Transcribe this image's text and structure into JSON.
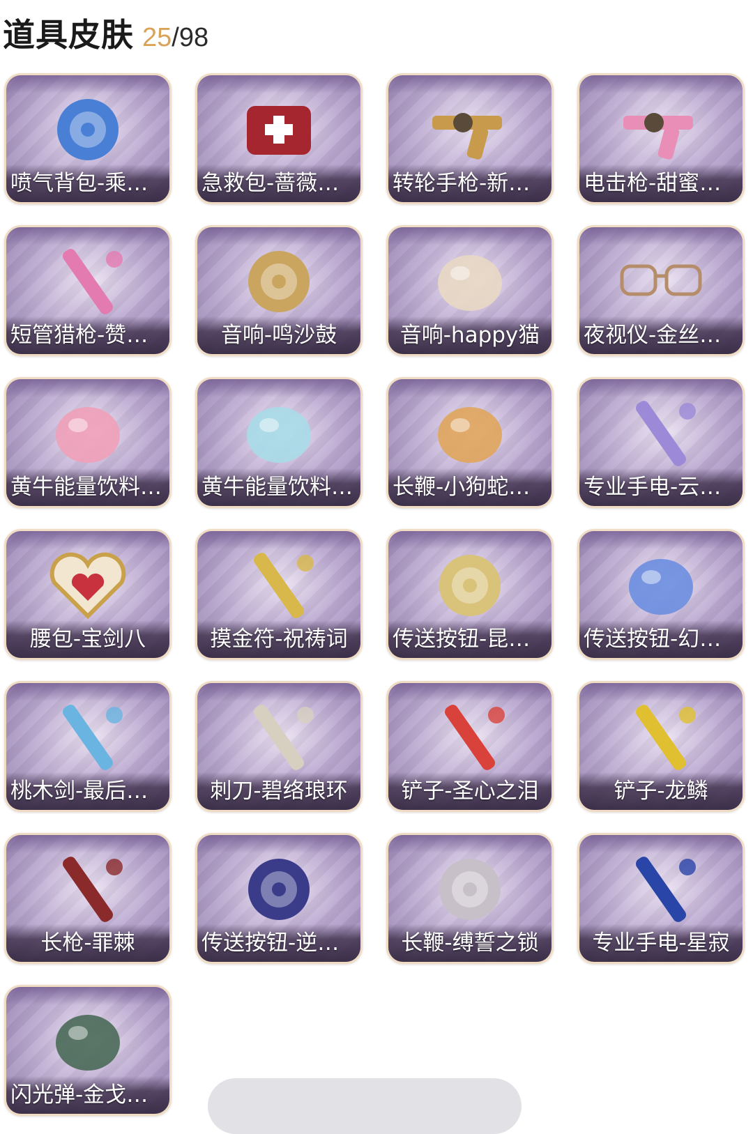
{
  "header": {
    "title": "道具皮肤",
    "count_current": "25",
    "count_total": "/98"
  },
  "items": [
    {
      "label": "喷气背包-乘风…",
      "icon": "jetpack-icon",
      "color": "#4a7fd6"
    },
    {
      "label": "急救包-蔷薇物…",
      "icon": "medkit-icon",
      "color": "#a5262f"
    },
    {
      "label": "转轮手枪-新星…",
      "icon": "revolver-icon",
      "color": "#c79a4c"
    },
    {
      "label": "电击枪-甜蜜泡…",
      "icon": "stun-gun-icon",
      "color": "#e98fb7"
    },
    {
      "label": "短管猎枪-赞萌…",
      "icon": "shotgun-icon",
      "color": "#e37ab0"
    },
    {
      "label": "音响-鸣沙鼓",
      "icon": "drum-icon",
      "color": "#c9a560"
    },
    {
      "label": "音响-happy猫",
      "icon": "cat-icon",
      "color": "#e8d8c4"
    },
    {
      "label": "夜视仪-金丝眼…",
      "icon": "glasses-icon",
      "color": "#b58d6a"
    },
    {
      "label": "黄牛能量饮料-…",
      "icon": "drink-cup-icon",
      "color": "#f0a0b8"
    },
    {
      "label": "黄牛能量饮料-…",
      "icon": "bottle-icon",
      "color": "#a8dbe8"
    },
    {
      "label": "长鞭-小狗蛇点…",
      "icon": "snake-icon",
      "color": "#e0a55c"
    },
    {
      "label": "专业手电-云端…",
      "icon": "flashlight-icon",
      "color": "#9c8ad8"
    },
    {
      "label": "腰包-宝剑八",
      "icon": "heart-bag-icon",
      "color": "#c8323e"
    },
    {
      "label": "摸金符-祝祷词",
      "icon": "amulet-icon",
      "color": "#d8b84a"
    },
    {
      "label": "传送按钮-昆仑…",
      "icon": "portal-ring-icon",
      "color": "#d9c27a"
    },
    {
      "label": "传送按钮-幻宠…",
      "icon": "pet-device-icon",
      "color": "#6c8ee0"
    },
    {
      "label": "桃木剑-最后的…",
      "icon": "sword-icon",
      "color": "#69b4e0"
    },
    {
      "label": "刺刀-碧络琅环",
      "icon": "dagger-icon",
      "color": "#d7d0c0"
    },
    {
      "label": "铲子-圣心之泪",
      "icon": "shovel-heart-icon",
      "color": "#d9423a"
    },
    {
      "label": "铲子-龙鳞",
      "icon": "shovel-gold-icon",
      "color": "#e0c030"
    },
    {
      "label": "长枪-罪棘",
      "icon": "spear-icon",
      "color": "#8a2a2a"
    },
    {
      "label": "传送按钮-逆时…",
      "icon": "pocket-watch-icon",
      "color": "#3a3c8a"
    },
    {
      "label": "长鞭-缚誓之锁",
      "icon": "chain-whip-icon",
      "color": "#c8c0c8"
    },
    {
      "label": "专业手电-星寂",
      "icon": "flashlight-blue-icon",
      "color": "#2a45a8"
    },
    {
      "label": "闪光弹-金戈玄…",
      "icon": "grenade-icon",
      "color": "#4a6a58"
    }
  ]
}
